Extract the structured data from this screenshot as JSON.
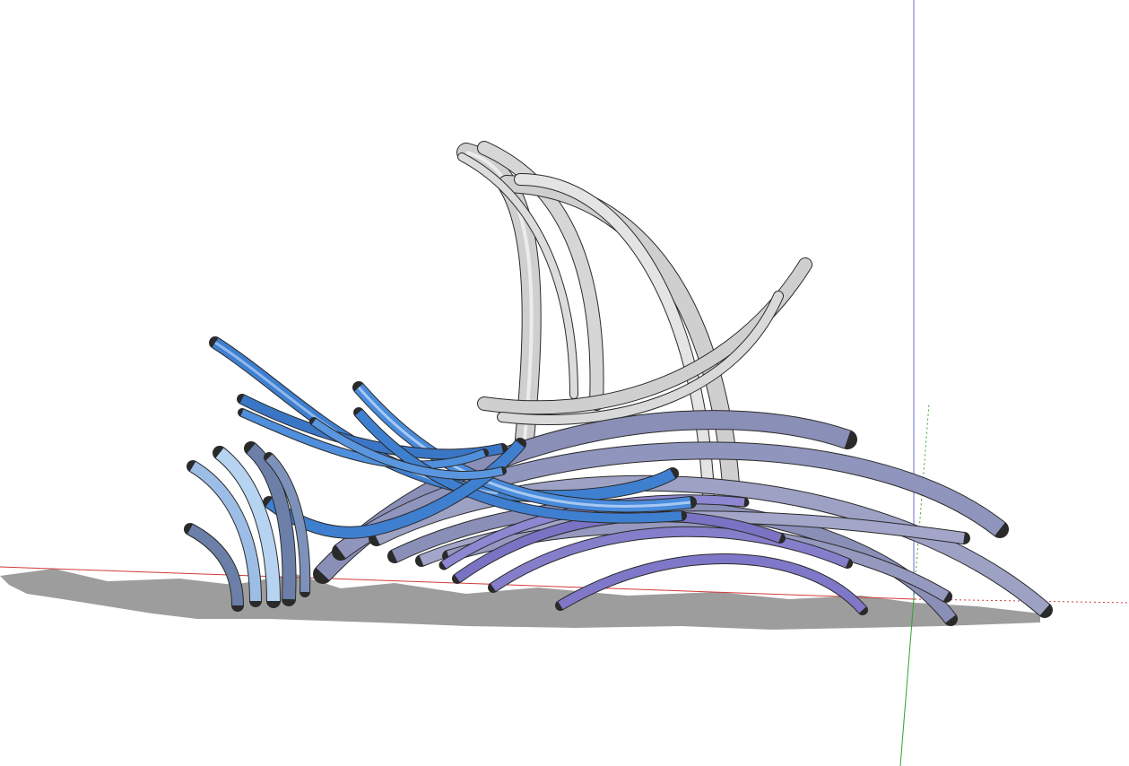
{
  "scene": {
    "background_color": "#ffffff",
    "axes": {
      "red_axis_color": "#d23a3a",
      "green_axis_color": "#2fa32f",
      "blue_axis_color": "#6b6bd6"
    },
    "shadow_color": "#8c8c8c",
    "sculpture": {
      "sail_color": "#cfcfcf",
      "sail_highlight": "#f2f2f2",
      "wave_lavender": "#8a8fb8",
      "wave_violet": "#7f78c8",
      "wave_blue": "#3f7fd0",
      "wave_light_blue": "#8fb8ec",
      "wave_slate": "#6b7fa8"
    }
  }
}
